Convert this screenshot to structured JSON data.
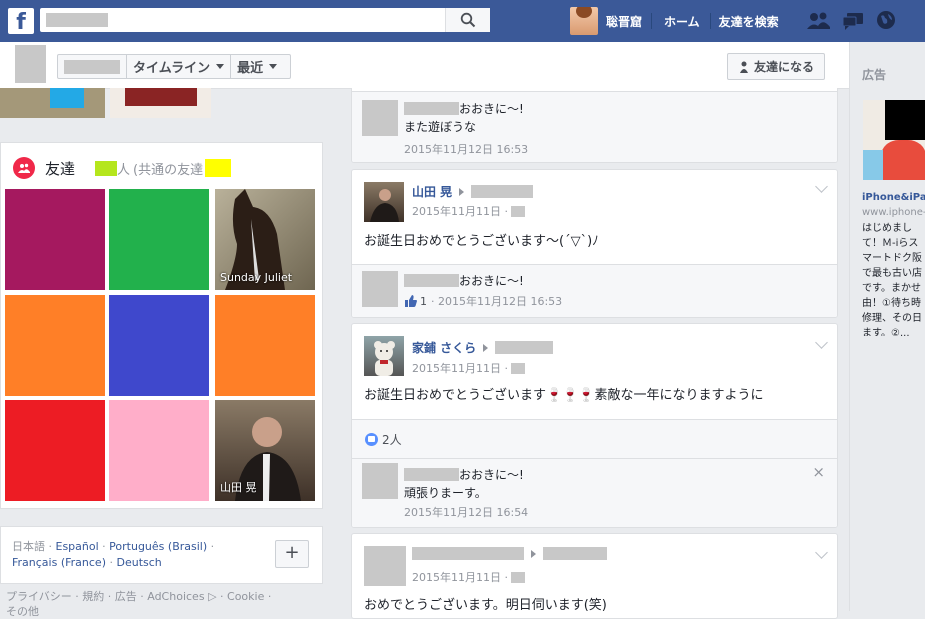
{
  "topbar": {
    "logo": "f",
    "username": "聡晋窟",
    "home": "ホーム",
    "find_friends": "友達を検索"
  },
  "nav": {
    "timeline": "タイムライン",
    "recent": "最近",
    "add_friend": "友達になる"
  },
  "friends": {
    "heading": "友達",
    "count_suffix": "人",
    "mutual": "(共通の友達",
    "tiles": [
      {
        "name": "",
        "color": "#a5195f"
      },
      {
        "name": "",
        "color": "#22b14c"
      },
      {
        "name": "Sunday Juliet",
        "color": "#5a4a3a"
      },
      {
        "name": "",
        "color": "#ff7f27"
      },
      {
        "name": "",
        "color": "#3f48cc"
      },
      {
        "name": "",
        "color": "#ff7f27"
      },
      {
        "name": "",
        "color": "#ed1c24"
      },
      {
        "name": "",
        "color": "#ffaec9"
      },
      {
        "name": "山田 晃",
        "color": "#4a3a30"
      }
    ]
  },
  "languages": {
    "current": "日本語",
    "links": [
      "Español",
      "Português (Brasil)",
      "Français (France)",
      "Deutsch"
    ],
    "add": "+"
  },
  "footer": {
    "links": "プライバシー · 規約 · 広告 · AdChoices",
    "cookie": " · Cookie ·",
    "more": "その他"
  },
  "ads": {
    "label": "広告",
    "title": "iPhone&iPad",
    "url": "www.iphone-",
    "body": "はじめまして！Ｍ-iらスマートドク阪で最も古い店です。まかせ由！①待ち時修理、その日ます。②..."
  },
  "feed": {
    "c0": {
      "comment_name": "おおきに～!",
      "comment_text": "また遊ぼうな",
      "comment_date": "2015年11月12日 16:53"
    },
    "p1": {
      "author": "山田 晃",
      "date": "2015年11月11日 ·",
      "text": "お誕生日おめでとうございます〜(´▽`)ﾉ",
      "comment_name": "おおきに～!",
      "comment_likes": "1",
      "comment_date": "· 2015年11月12日 16:53"
    },
    "p2": {
      "author": "家鋪 さくら",
      "date": "2015年11月11日 ·",
      "text": "お誕生日おめでとうございます🍷🍷🍷素敵な一年になりますように",
      "likes": "2人",
      "comment_name": "おおきに～!",
      "comment_text": "頑張りまーす。",
      "comment_date": "2015年11月12日 16:54",
      "close": "×"
    },
    "p3": {
      "date": "2015年11月11日 ·",
      "text": "おめでとうございます。明日伺います(笑)"
    }
  }
}
